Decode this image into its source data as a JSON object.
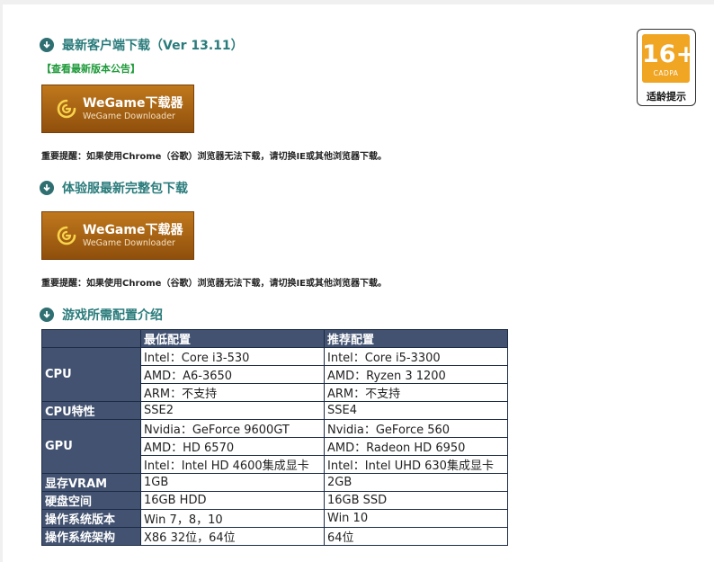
{
  "sections": {
    "client_download": {
      "title": "最新客户端下载（Ver 13.11）"
    },
    "notice_link": "【查看最新版本公告】",
    "trial_download": {
      "title": "体验服最新完整包下载"
    },
    "requirements": {
      "title": "游戏所需配置介绍"
    }
  },
  "download_button": {
    "main": "WeGame下载器",
    "sub": "WeGame Downloader"
  },
  "note_text": "重要提醒：如果使用Chrome（谷歌）浏览器无法下载，请切换IE或其他浏览器下载。",
  "age_rating": {
    "number": "16+",
    "org": "CADPA",
    "label": "适龄提示"
  },
  "config_table": {
    "headers": [
      "",
      "最低配置",
      "推荐配置"
    ],
    "cpu": {
      "label": "CPU",
      "min": [
        "Intel：Core i3-530",
        "AMD：A6-3650",
        "ARM：不支持"
      ],
      "rec": [
        "Intel：Core i5-3300",
        "AMD：Ryzen 3 1200",
        "ARM：不支持"
      ]
    },
    "cpu_feature": {
      "label": "CPU特性",
      "min": "SSE2",
      "rec": "SSE4"
    },
    "gpu": {
      "label": "GPU",
      "min": [
        "Nvidia：GeForce 9600GT",
        "AMD：HD 6570",
        "Intel：Intel HD 4600集成显卡"
      ],
      "rec": [
        "Nvidia：GeForce 560",
        "AMD：Radeon HD 6950",
        "Intel：Intel UHD 630集成显卡"
      ]
    },
    "vram": {
      "label": "显存VRAM",
      "min": "1GB",
      "rec": "2GB"
    },
    "disk": {
      "label": "硬盘空间",
      "min": "16GB HDD",
      "rec": "16GB SSD"
    },
    "os_version": {
      "label": "操作系统版本",
      "min": "Win 7，8，10",
      "rec": "Win 10"
    },
    "os_arch": {
      "label": "操作系统架构",
      "min": "X86 32位，64位",
      "rec": "64位"
    }
  },
  "colors": {
    "section_title": "#2a7b7b",
    "notice_link": "#1f9a3a",
    "table_header": "#425270",
    "age_badge": "#f0a523",
    "download_button": "#b06a16"
  }
}
